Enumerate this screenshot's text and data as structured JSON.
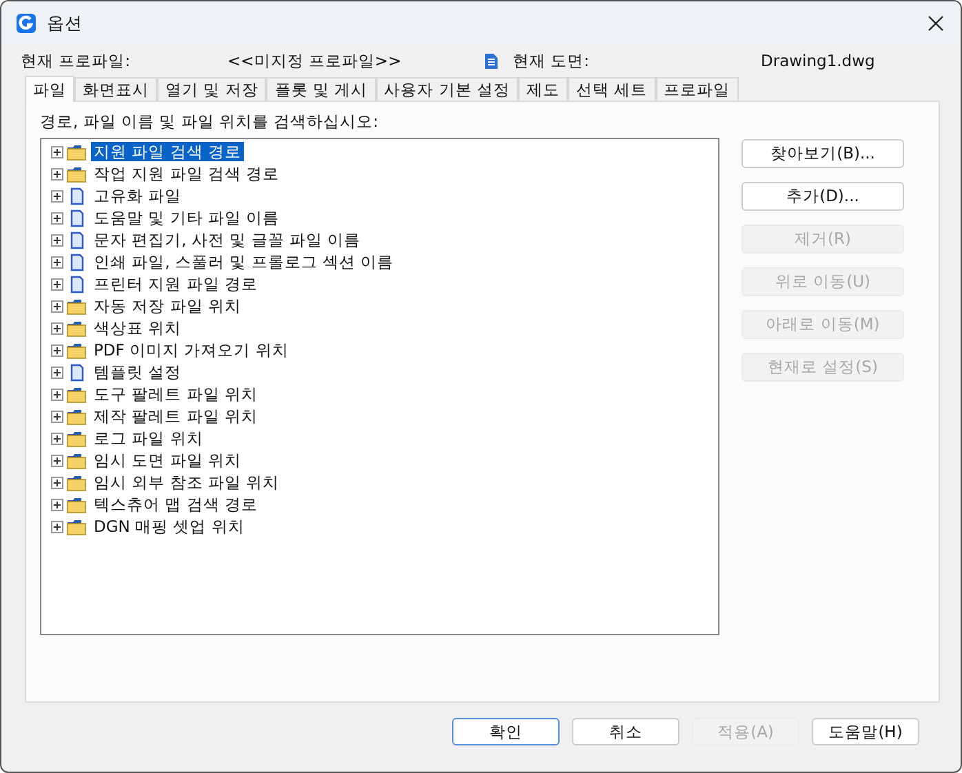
{
  "window": {
    "title": "옵션"
  },
  "header": {
    "profile_label": "현재 프로파일:",
    "profile_value": "<<미지정 프로파일>>",
    "drawing_label": "현재 도면:",
    "drawing_value": "Drawing1.dwg"
  },
  "tabs": [
    {
      "label": "파일",
      "selected": true
    },
    {
      "label": "화면표시",
      "selected": false
    },
    {
      "label": "열기 및 저장",
      "selected": false
    },
    {
      "label": "플롯 및 게시",
      "selected": false
    },
    {
      "label": "사용자 기본 설정",
      "selected": false
    },
    {
      "label": "제도",
      "selected": false
    },
    {
      "label": "선택 세트",
      "selected": false
    },
    {
      "label": "프로파일",
      "selected": false
    }
  ],
  "tree_label": "경로, 파일 이름 및 파일 위치를 검색하십시오:",
  "tree": [
    {
      "label": "지원 파일 검색 경로",
      "kind": "folder",
      "selected": true
    },
    {
      "label": "작업 지원 파일 검색 경로",
      "kind": "folder",
      "selected": false
    },
    {
      "label": "고유화 파일",
      "kind": "file",
      "selected": false
    },
    {
      "label": "도움말 및 기타 파일 이름",
      "kind": "file",
      "selected": false
    },
    {
      "label": "문자 편집기, 사전 및 글꼴 파일 이름",
      "kind": "file",
      "selected": false
    },
    {
      "label": "인쇄 파일, 스풀러 및 프롤로그 섹션 이름",
      "kind": "file",
      "selected": false
    },
    {
      "label": "프린터 지원 파일 경로",
      "kind": "file",
      "selected": false
    },
    {
      "label": "자동 저장 파일 위치",
      "kind": "folder",
      "selected": false
    },
    {
      "label": "색상표 위치",
      "kind": "folder",
      "selected": false
    },
    {
      "label": "PDF 이미지 가져오기 위치",
      "kind": "folder",
      "selected": false
    },
    {
      "label": "템플릿 설정",
      "kind": "file",
      "selected": false
    },
    {
      "label": "도구 팔레트 파일 위치",
      "kind": "folder",
      "selected": false
    },
    {
      "label": "제작 팔레트 파일 위치",
      "kind": "folder",
      "selected": false
    },
    {
      "label": "로그 파일 위치",
      "kind": "folder",
      "selected": false
    },
    {
      "label": "임시 도면 파일 위치",
      "kind": "folder",
      "selected": false
    },
    {
      "label": "임시 외부 참조 파일 위치",
      "kind": "folder",
      "selected": false
    },
    {
      "label": "텍스츄어 맵 검색 경로",
      "kind": "folder",
      "selected": false
    },
    {
      "label": "DGN 매핑 셋업 위치",
      "kind": "folder",
      "selected": false
    }
  ],
  "side_buttons": [
    {
      "label": "찾아보기(B)...",
      "disabled": false
    },
    {
      "label": "추가(D)...",
      "disabled": false
    },
    {
      "label": "제거(R)",
      "disabled": true
    },
    {
      "label": "위로 이동(U)",
      "disabled": true
    },
    {
      "label": "아래로 이동(M)",
      "disabled": true
    },
    {
      "label": "현재로 설정(S)",
      "disabled": true
    }
  ],
  "footer_buttons": [
    {
      "label": "확인",
      "disabled": false,
      "default": true
    },
    {
      "label": "취소",
      "disabled": false,
      "default": false
    },
    {
      "label": "적용(A)",
      "disabled": true,
      "default": false
    },
    {
      "label": "도움말(H)",
      "disabled": false,
      "default": false
    }
  ]
}
